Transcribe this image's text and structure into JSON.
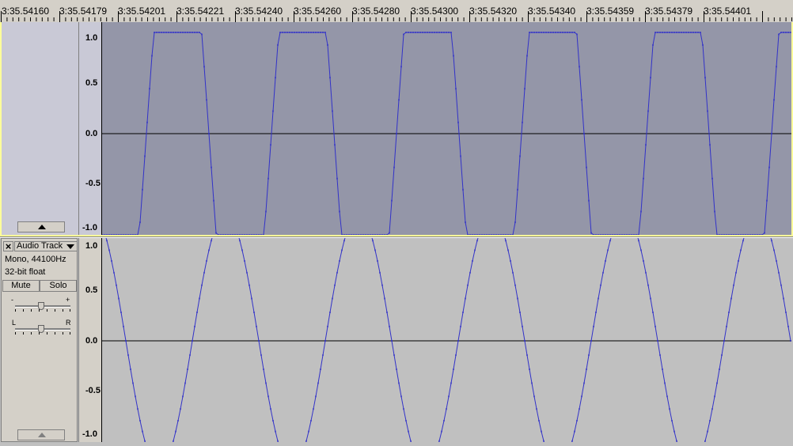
{
  "ruler": {
    "labels": [
      "3:35.54160",
      "3:35.54179",
      "3:35.54201",
      "3:35.54221",
      "3:35.54240",
      "3:35.54260",
      "3:35.54280",
      "3:35.54300",
      "3:35.54320",
      "3:35.54340",
      "3:35.54359",
      "3:35.54379",
      "3:35.54401"
    ]
  },
  "track_top": {
    "amplitude_labels": [
      "1.0",
      "0.5",
      "0.0",
      "-0.5",
      "-1.0"
    ]
  },
  "track_bottom": {
    "name": "Audio Track",
    "format": "Mono, 44100Hz",
    "bit_depth": "32-bit float",
    "mute_label": "Mute",
    "solo_label": "Solo",
    "gain_minus": "-",
    "gain_plus": "+",
    "pan_left": "L",
    "pan_right": "R",
    "amplitude_labels": [
      "1.0",
      "0.5",
      "0.0",
      "-0.5",
      "-1.0"
    ]
  },
  "colors": {
    "waveform": "#3232c8",
    "top_wave_bg": "#9496a8",
    "bottom_wave_bg": "#c0c0c0",
    "selection_border": "#ffff99"
  }
}
